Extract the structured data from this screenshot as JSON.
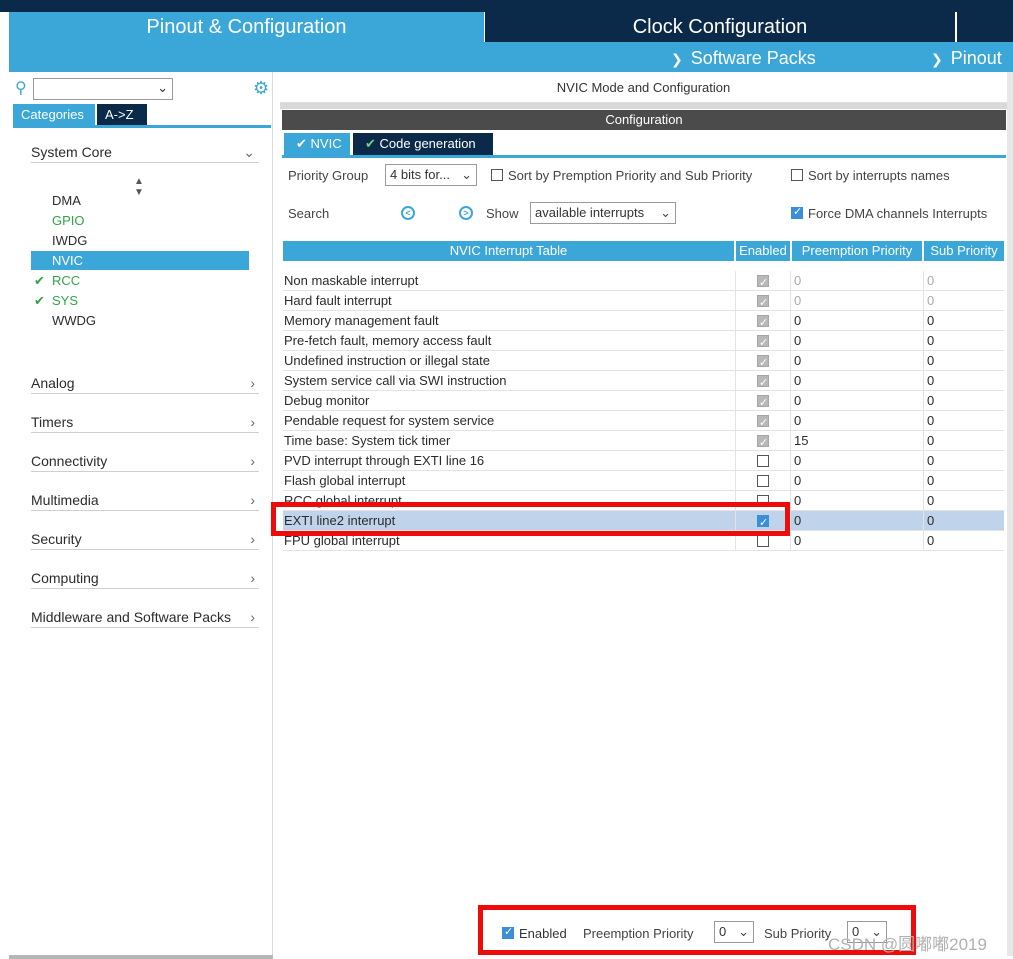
{
  "app": {
    "tabs": {
      "pinout": "Pinout & Configuration",
      "clock": "Clock Configuration"
    },
    "submenus": {
      "software_packs": "Software Packs",
      "pinout": "Pinout"
    }
  },
  "sidebar": {
    "search": {
      "value": ""
    },
    "tabs": {
      "categories": "Categories",
      "atoz": "A->Z"
    },
    "groups": {
      "system_core": "System Core",
      "analog": "Analog",
      "timers": "Timers",
      "connectivity": "Connectivity",
      "multimedia": "Multimedia",
      "security": "Security",
      "computing": "Computing",
      "middleware": "Middleware and Software Packs"
    },
    "items": [
      {
        "label": "DMA",
        "state": "normal"
      },
      {
        "label": "GPIO",
        "state": "green"
      },
      {
        "label": "IWDG",
        "state": "normal"
      },
      {
        "label": "NVIC",
        "state": "selected"
      },
      {
        "label": "RCC",
        "state": "checked"
      },
      {
        "label": "SYS",
        "state": "checked"
      },
      {
        "label": "WWDG",
        "state": "normal"
      }
    ]
  },
  "main": {
    "title": "NVIC Mode and Configuration",
    "config_label": "Configuration",
    "tabs": {
      "nvic": "NVIC",
      "codegen": "Code generation"
    },
    "priority_group": {
      "label": "Priority Group",
      "value": "4 bits for..."
    },
    "sort_preemption": {
      "label": "Sort by Premption Priority and Sub Priority",
      "checked": false
    },
    "sort_names": {
      "label": "Sort by interrupts names",
      "checked": false
    },
    "search_label": "Search",
    "show": {
      "label": "Show",
      "value": "available interrupts"
    },
    "force_dma": {
      "label": "Force DMA channels Interrupts",
      "checked": true
    },
    "table": {
      "headers": {
        "name": "NVIC Interrupt Table",
        "enabled": "Enabled",
        "preemption": "Preemption Priority",
        "sub": "Sub Priority"
      },
      "rows": [
        {
          "name": "Non maskable interrupt",
          "enabled": "locked",
          "preemption": "0",
          "sub": "0",
          "dim": true
        },
        {
          "name": "Hard fault interrupt",
          "enabled": "locked",
          "preemption": "0",
          "sub": "0",
          "dim": true
        },
        {
          "name": "Memory management fault",
          "enabled": "locked",
          "preemption": "0",
          "sub": "0",
          "dim": false
        },
        {
          "name": "Pre-fetch fault, memory access fault",
          "enabled": "locked",
          "preemption": "0",
          "sub": "0",
          "dim": false
        },
        {
          "name": "Undefined instruction or illegal state",
          "enabled": "locked",
          "preemption": "0",
          "sub": "0",
          "dim": false
        },
        {
          "name": "System service call via SWI instruction",
          "enabled": "locked",
          "preemption": "0",
          "sub": "0",
          "dim": false
        },
        {
          "name": "Debug monitor",
          "enabled": "locked",
          "preemption": "0",
          "sub": "0",
          "dim": false
        },
        {
          "name": "Pendable request for system service",
          "enabled": "locked",
          "preemption": "0",
          "sub": "0",
          "dim": false
        },
        {
          "name": "Time base: System tick timer",
          "enabled": "locked",
          "preemption": "15",
          "sub": "0",
          "dim": false
        },
        {
          "name": "PVD interrupt through EXTI line 16",
          "enabled": "off",
          "preemption": "0",
          "sub": "0",
          "dim": false
        },
        {
          "name": "Flash global interrupt",
          "enabled": "off",
          "preemption": "0",
          "sub": "0",
          "dim": false
        },
        {
          "name": "RCC global interrupt",
          "enabled": "off",
          "preemption": "0",
          "sub": "0",
          "dim": false
        },
        {
          "name": "EXTI line2 interrupt",
          "enabled": "on",
          "preemption": "0",
          "sub": "0",
          "dim": false,
          "selected": true
        },
        {
          "name": "FPU global interrupt",
          "enabled": "off",
          "preemption": "0",
          "sub": "0",
          "dim": false
        }
      ]
    },
    "bottom": {
      "enabled_label": "Enabled",
      "preemption_label": "Preemption Priority",
      "preemption_value": "0",
      "sub_label": "Sub Priority",
      "sub_value": "0"
    }
  },
  "watermark": "CSDN @圆嘟嘟2019",
  "colors": {
    "accent": "#3ba7d8",
    "dark": "#0b2a4a",
    "highlight": "#ee0b0b",
    "selected_row": "#bfd3ea",
    "ok_green": "#30a34a"
  }
}
